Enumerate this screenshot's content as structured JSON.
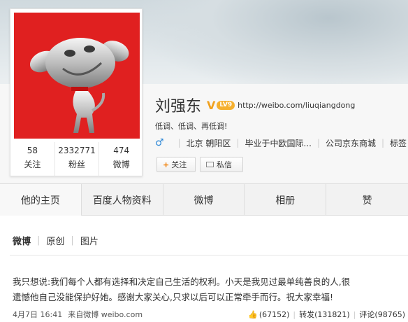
{
  "profile": {
    "name": "刘强东",
    "verified_badge": "V",
    "level": "LV9",
    "url": "http://weibo.com/liuqiangdong",
    "intro": "低调、低调、再低调!",
    "gender_icon": "♂",
    "location": "北京 朝阳区",
    "education": "毕业于中欧国际...",
    "company": "公司京东商城",
    "tags_label": "标签"
  },
  "stats": [
    {
      "num": "58",
      "label": "关注"
    },
    {
      "num": "2332771",
      "label": "粉丝"
    },
    {
      "num": "474",
      "label": "微博"
    }
  ],
  "buttons": {
    "follow": "关注",
    "message": "私信"
  },
  "tabs": [
    "他的主页",
    "百度人物资料",
    "微博",
    "相册",
    "赞"
  ],
  "subtabs": [
    "微博",
    "原创",
    "图片"
  ],
  "post": {
    "line1": "我只想说:我们每个人都有选择和决定自己生活的权利。小天是我见过最单纯善良的人,很",
    "line2": "遗憾他自己没能保护好她。感谢大家关心,只求以后可以正常牵手而行。祝大家幸福!",
    "time": "4月7日 16:41",
    "source": "来自微博 weibo.com",
    "likes": "(67152)",
    "reposts": "转发(131821)",
    "comments": "评论(98765)"
  },
  "colors": {
    "avatar_bg": "#e02020",
    "accent": "#f0a11f",
    "link": "#2a86d6"
  }
}
